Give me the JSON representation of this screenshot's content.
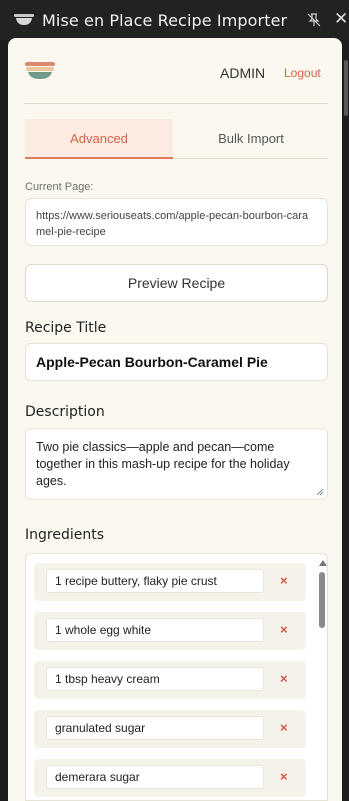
{
  "window": {
    "title": "Mise en Place Recipe Importer",
    "pin_icon": "pin-off-icon",
    "close_label": "✕"
  },
  "header": {
    "logo_icon": "bowl-logo-icon",
    "user_label": "ADMIN",
    "logout_label": "Logout"
  },
  "tabs": [
    {
      "label": "Advanced",
      "active": true
    },
    {
      "label": "Bulk Import",
      "active": false
    }
  ],
  "current_page": {
    "label": "Current Page:",
    "url": "https://www.seriouseats.com/apple-pecan-bourbon-caramel-pie-recipe"
  },
  "preview_button": {
    "label": "Preview Recipe"
  },
  "recipe_title": {
    "label": "Recipe Title",
    "value": "Apple-Pecan Bourbon-Caramel Pie"
  },
  "description": {
    "label": "Description",
    "value": "Two pie classics—apple and pecan—come together in this mash-up recipe for the holiday ages."
  },
  "ingredients": {
    "label": "Ingredients",
    "remove_label": "×",
    "items": [
      "1 recipe buttery, flaky pie crust",
      "1 whole egg white",
      "1 tbsp heavy cream",
      "granulated sugar",
      "demerara sugar"
    ]
  },
  "colors": {
    "accent": "#d2644a",
    "panel_bg": "#fbf8ef",
    "titlebar_bg": "#222222",
    "remove": "#d8524a"
  }
}
